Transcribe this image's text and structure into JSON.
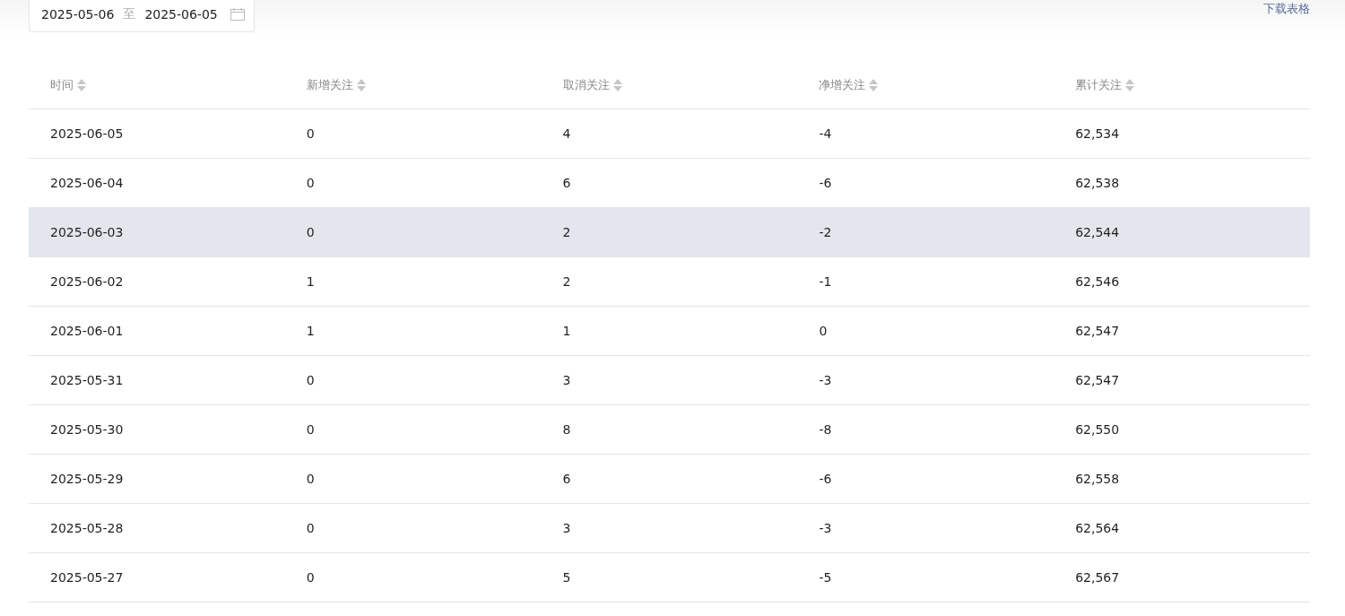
{
  "date_range": {
    "start": "2025-05-06",
    "separator": "至",
    "end": "2025-06-05"
  },
  "download_link": "下载表格",
  "table": {
    "columns": [
      "时间",
      "新增关注",
      "取消关注",
      "净增关注",
      "累计关注"
    ],
    "rows": [
      {
        "cells": [
          "2025-06-05",
          "0",
          "4",
          "-4",
          "62,534"
        ],
        "selected": false
      },
      {
        "cells": [
          "2025-06-04",
          "0",
          "6",
          "-6",
          "62,538"
        ],
        "selected": false
      },
      {
        "cells": [
          "2025-06-03",
          "0",
          "2",
          "-2",
          "62,544"
        ],
        "selected": true
      },
      {
        "cells": [
          "2025-06-02",
          "1",
          "2",
          "-1",
          "62,546"
        ],
        "selected": false
      },
      {
        "cells": [
          "2025-06-01",
          "1",
          "1",
          "0",
          "62,547"
        ],
        "selected": false
      },
      {
        "cells": [
          "2025-05-31",
          "0",
          "3",
          "-3",
          "62,547"
        ],
        "selected": false
      },
      {
        "cells": [
          "2025-05-30",
          "0",
          "8",
          "-8",
          "62,550"
        ],
        "selected": false
      },
      {
        "cells": [
          "2025-05-29",
          "0",
          "6",
          "-6",
          "62,558"
        ],
        "selected": false
      },
      {
        "cells": [
          "2025-05-28",
          "0",
          "3",
          "-3",
          "62,564"
        ],
        "selected": false
      },
      {
        "cells": [
          "2025-05-27",
          "0",
          "5",
          "-5",
          "62,567"
        ],
        "selected": false
      }
    ]
  }
}
